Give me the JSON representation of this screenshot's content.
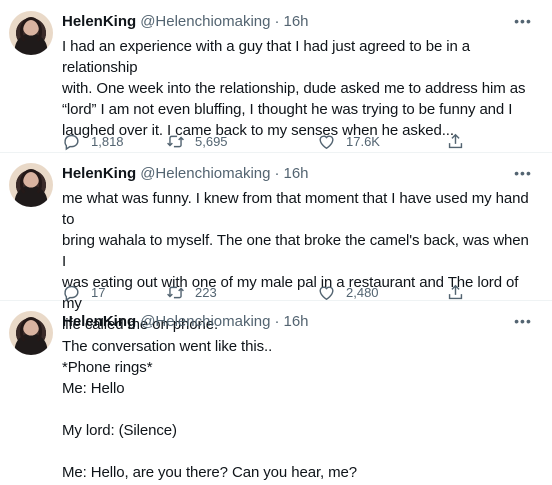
{
  "tweets": [
    {
      "name": "HelenKing",
      "handle": "@Helenchiomaking",
      "separator": "·",
      "time": "16h",
      "text": "I had an experience with a guy that I had just agreed to be in a relationship\nwith. One week into the relationship, dude asked me to address him as\n“lord” I am not even bluffing, I thought he was trying to be funny and I\nlaughed over it. I came back to my senses when he asked...",
      "replies": "1,818",
      "retweets": "5,695",
      "likes": "17.6K"
    },
    {
      "name": "HelenKing",
      "handle": "@Helenchiomaking",
      "separator": "·",
      "time": "16h",
      "text": "me what was funny. I knew from that moment that I have used my hand to\nbring wahala to myself. The one that broke the camel's back, was when I\nwas eating out with one of my male pal in a restaurant and The lord of my\nlife called me on phone.",
      "replies": "17",
      "retweets": "223",
      "likes": "2,480"
    },
    {
      "name": "HelenKing",
      "handle": "@Helenchiomaking",
      "separator": "·",
      "time": "16h",
      "text": "The conversation went like this..\n*Phone rings*\nMe: Hello\n\nMy lord: (Silence)\n\nMe: Hello, are you there? Can you hear, me?"
    }
  ],
  "icons": {
    "reply": "reply-icon",
    "retweet": "retweet-icon",
    "like": "heart-icon",
    "share": "share-icon",
    "more": "more-icon"
  },
  "more_glyph": "•••"
}
